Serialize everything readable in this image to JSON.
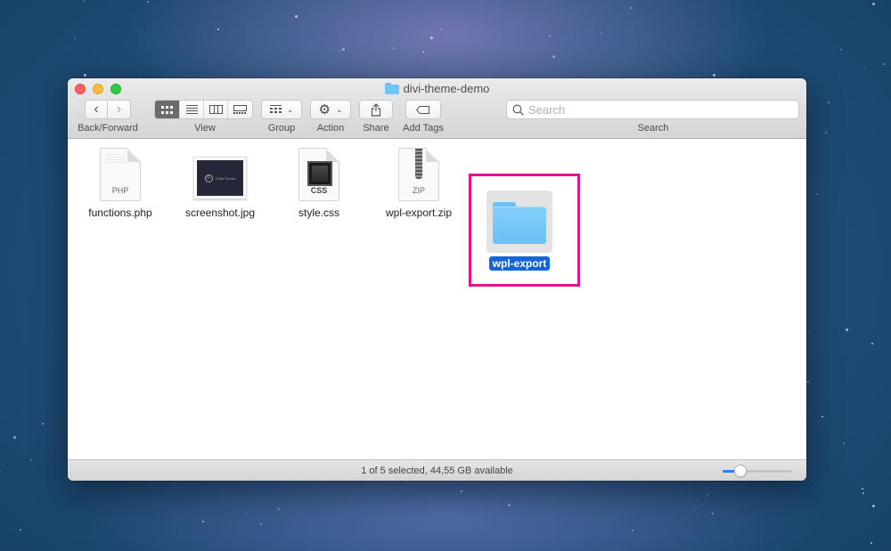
{
  "window": {
    "title": "divi-theme-demo",
    "title_icon": "folder-icon"
  },
  "toolbar": {
    "back_forward_label": "Back/Forward",
    "view_label": "View",
    "group_label": "Group",
    "action_label": "Action",
    "share_label": "Share",
    "add_tags_label": "Add Tags",
    "search_label": "Search",
    "search_placeholder": "Search",
    "search_value": "",
    "view_modes": [
      {
        "name": "icon-view",
        "active": true
      },
      {
        "name": "list-view",
        "active": false
      },
      {
        "name": "column-view",
        "active": false
      },
      {
        "name": "gallery-view",
        "active": false
      }
    ]
  },
  "files": [
    {
      "name": "functions.php",
      "type": "PHP",
      "icon": "php-file-icon"
    },
    {
      "name": "screenshot.jpg",
      "type": "JPG",
      "icon": "image-thumbnail-icon",
      "thumbnail_text": "Child Theme",
      "thumbnail_logo": "D"
    },
    {
      "name": "style.css",
      "type": "CSS",
      "icon": "css-file-icon"
    },
    {
      "name": "wpl-export.zip",
      "type": "ZIP",
      "icon": "zip-file-icon"
    },
    {
      "name": "wpl-export",
      "type": "folder",
      "icon": "folder-icon",
      "selected": true
    }
  ],
  "highlight_color": "#e5128f",
  "status": {
    "text": "1 of 5 selected, 44,55 GB available",
    "icon_size_slider_fraction": 0.25
  }
}
